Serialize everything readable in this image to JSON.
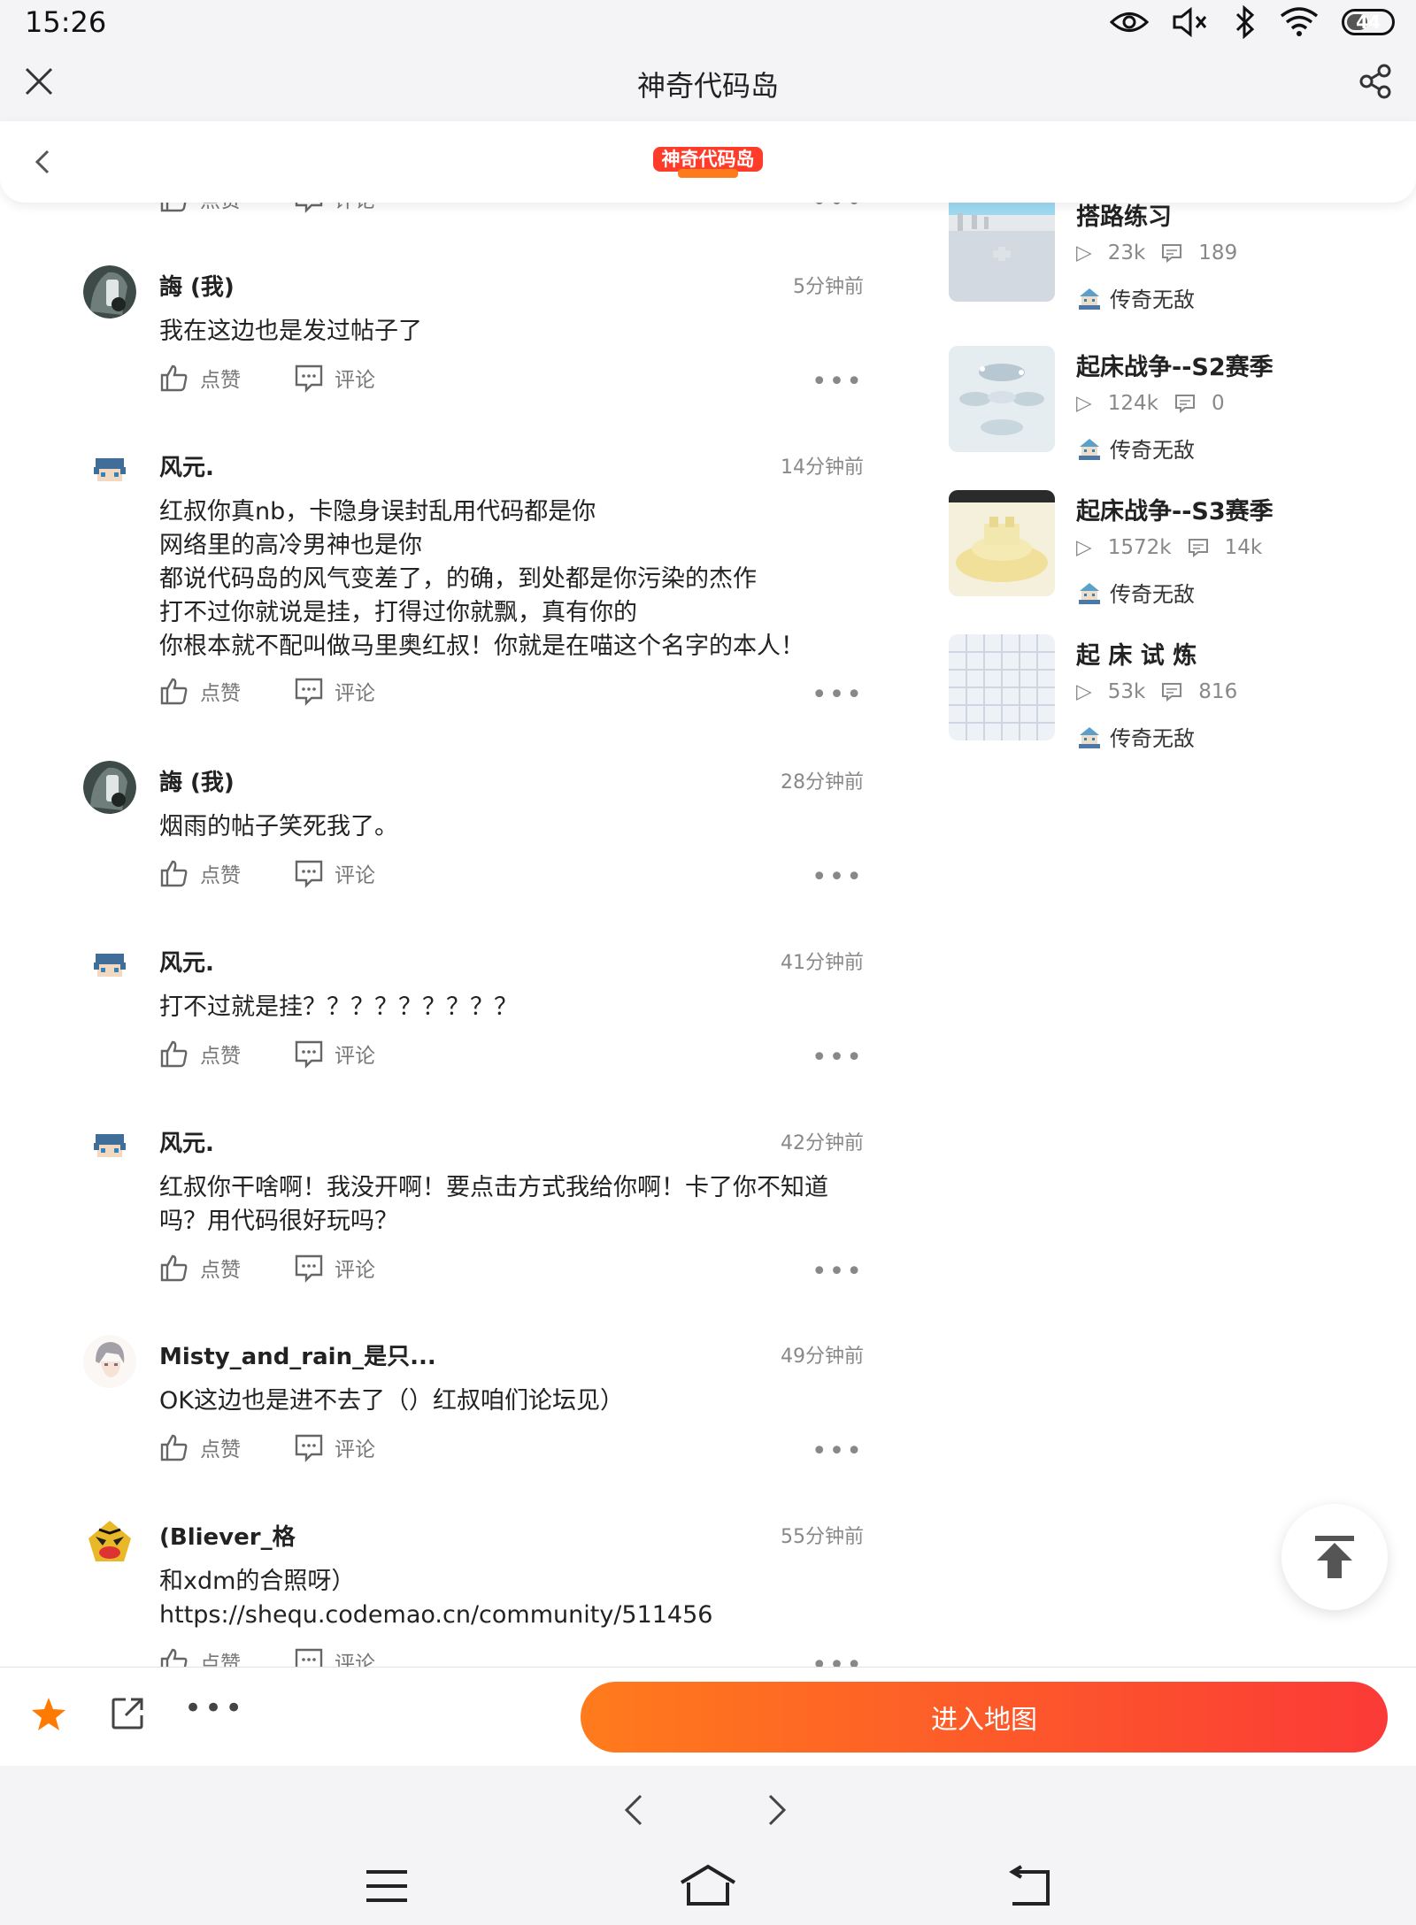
{
  "status": {
    "time": "15:26",
    "battery": "44"
  },
  "titlebar": {
    "title": "神奇代码岛"
  },
  "header": {
    "logo_text": "神奇代码岛"
  },
  "action_labels": {
    "like": "点赞",
    "comment": "评论"
  },
  "partial_top": {
    "like": "点赞",
    "comment": "评论"
  },
  "comments": [
    {
      "name": "誨 (我)",
      "time": "5分钟前",
      "text": "我在这边也是发过帖子了"
    },
    {
      "name": "风元.",
      "time": "14分钟前",
      "text": "红叔你真nb，卡隐身误封乱用代码都是你\n网络里的高冷男神也是你\n都说代码岛的风气变差了，的确，到处都是你污染的杰作\n打不过你就说是挂，打得过你就飘，真有你的\n你根本就不配叫做马里奥红叔！你就是在喵这个名字的本人！"
    },
    {
      "name": "誨 (我)",
      "time": "28分钟前",
      "text": "烟雨的帖子笑死我了。"
    },
    {
      "name": "风元.",
      "time": "41分钟前",
      "text": "打不过就是挂？？？？？？？？？"
    },
    {
      "name": "风元.",
      "time": "42分钟前",
      "text": "红叔你干啥啊！我没开啊！要点击方式我给你啊！卡了你不知道吗？用代码很好玩吗？"
    },
    {
      "name": "Misty_and_rain_是只...",
      "time": "49分钟前",
      "text": "OK这边也是进不去了（）红叔咱们论坛见）"
    },
    {
      "name": "(Bliever_格",
      "time": "55分钟前",
      "text": "和xdm的合照呀）\nhttps://shequ.codemao.cn/community/511456"
    }
  ],
  "recommendations": [
    {
      "title": "搭路练习",
      "plays": "23k",
      "comments": "189",
      "author": "传奇无敌"
    },
    {
      "title": "起床战争--S2赛季",
      "plays": "124k",
      "comments": "0",
      "author": "传奇无敌"
    },
    {
      "title": "起床战争--S3赛季",
      "plays": "1572k",
      "comments": "14k",
      "author": "传奇无敌"
    },
    {
      "title": "起 床 试 炼",
      "plays": "53k",
      "comments": "816",
      "author": "传奇无敌"
    }
  ],
  "bottom": {
    "enter_label": "进入地图"
  },
  "colors": {
    "accent_start": "#ff7b1c",
    "accent_end": "#fb3a37",
    "star": "#ff7a00"
  }
}
